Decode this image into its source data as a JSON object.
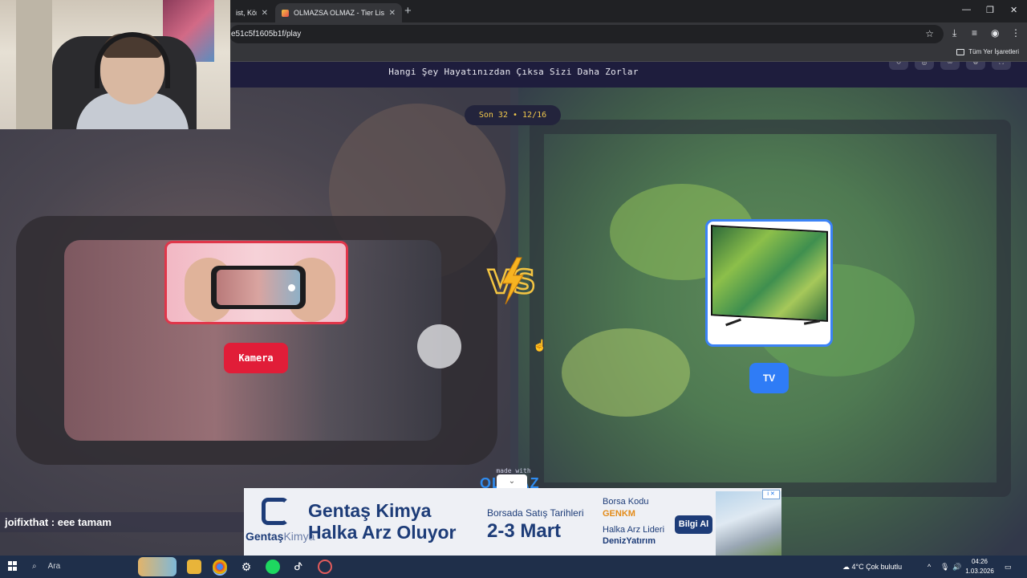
{
  "browser": {
    "tabs": [
      {
        "label": "ist, Kör S",
        "active": false
      },
      {
        "label": "OLMAZSA OLMAZ - Tier List, K",
        "active": true
      }
    ],
    "new_tab_glyph": "+",
    "url": "e51c5f1605b1f/play",
    "bookmarks_all": "Tüm Yer İşaretleri",
    "window_controls": [
      "—",
      "❐",
      "✕"
    ]
  },
  "page": {
    "header_title": "Hangi Şey Hayatınızdan Çıksa Sizi Daha Zorlar",
    "round": "Son 32 • 12/16",
    "left_option": {
      "label": "Kamera",
      "color": "#e11d38"
    },
    "right_option": {
      "label": "TV",
      "color": "#2f7cf6"
    },
    "vs": "VS",
    "made_with": "made with",
    "chevron": "⌄"
  },
  "ad": {
    "logo_brand": "Gentaş",
    "logo_suffix": "Kimya",
    "title": "Gentaş Kimya Halka Arz Oluyor",
    "dates_label": "Borsada Satış Tarihleri",
    "dates": "2-3 Mart",
    "code_label": "Borsa Kodu",
    "code": "GENKM",
    "leader_label": "Halka Arz Lideri",
    "leader": "DenizYatırım",
    "button": "Bilgi Al",
    "badge": "i ✕"
  },
  "chat": {
    "user": "joifixthat",
    "message": " : eee tamam"
  },
  "taskbar": {
    "search_placeholder": "Ara",
    "weather": "4°C  Çok bulutlu",
    "time": "04:26",
    "date": "1.03.2026"
  }
}
